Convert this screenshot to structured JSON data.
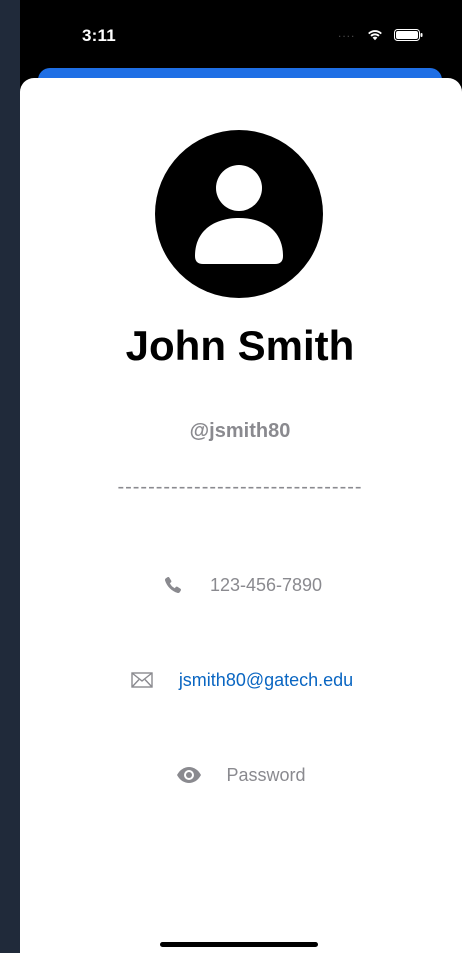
{
  "status_bar": {
    "time": "3:11",
    "signal_dots": "....",
    "wifi_icon": "wifi-icon",
    "battery_icon": "battery-icon"
  },
  "profile": {
    "avatar_icon": "person-circle-icon",
    "name": "John Smith",
    "username": "@jsmith80",
    "divider": "--------------------------------"
  },
  "contact": {
    "phone": {
      "icon": "phone-icon",
      "value": "123-456-7890"
    },
    "email": {
      "icon": "envelope-icon",
      "value": "jsmith80@gatech.edu"
    },
    "password": {
      "icon": "eye-icon",
      "placeholder": "Password"
    }
  },
  "colors": {
    "accent_blue": "#1f6fe5",
    "link_blue": "#0a66c2",
    "secondary_gray": "#8a8a8f"
  }
}
